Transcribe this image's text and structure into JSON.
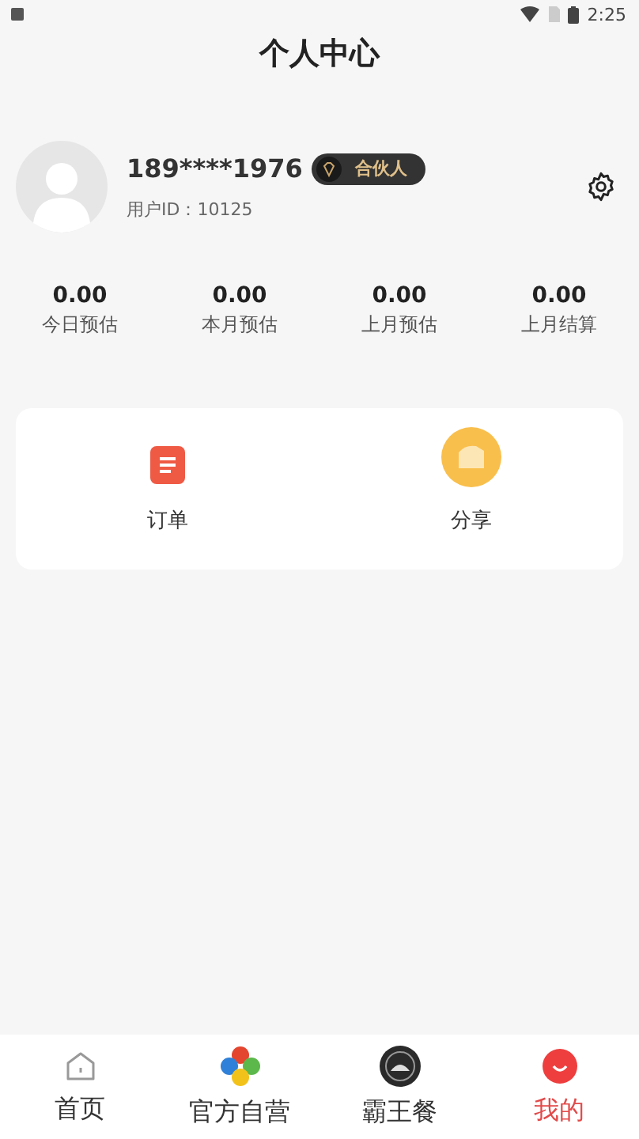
{
  "status_bar": {
    "time": "2:25"
  },
  "title": "个人中心",
  "profile": {
    "phone": "189****1976",
    "badge": "合伙人",
    "user_id": "用户ID：10125"
  },
  "stats": [
    {
      "value": "0.00",
      "label": "今日预估"
    },
    {
      "value": "0.00",
      "label": "本月预估"
    },
    {
      "value": "0.00",
      "label": "上月预估"
    },
    {
      "value": "0.00",
      "label": "上月结算"
    }
  ],
  "actions": [
    {
      "kind": "order",
      "label": "订单"
    },
    {
      "kind": "share",
      "label": "分享"
    }
  ],
  "tabs": [
    {
      "kind": "home",
      "label": "首页",
      "selected": false
    },
    {
      "kind": "clover",
      "label": "官方自营",
      "selected": false
    },
    {
      "kind": "emblem",
      "label": "霸王餐",
      "selected": false
    },
    {
      "kind": "smile",
      "label": "我的",
      "selected": true
    }
  ]
}
